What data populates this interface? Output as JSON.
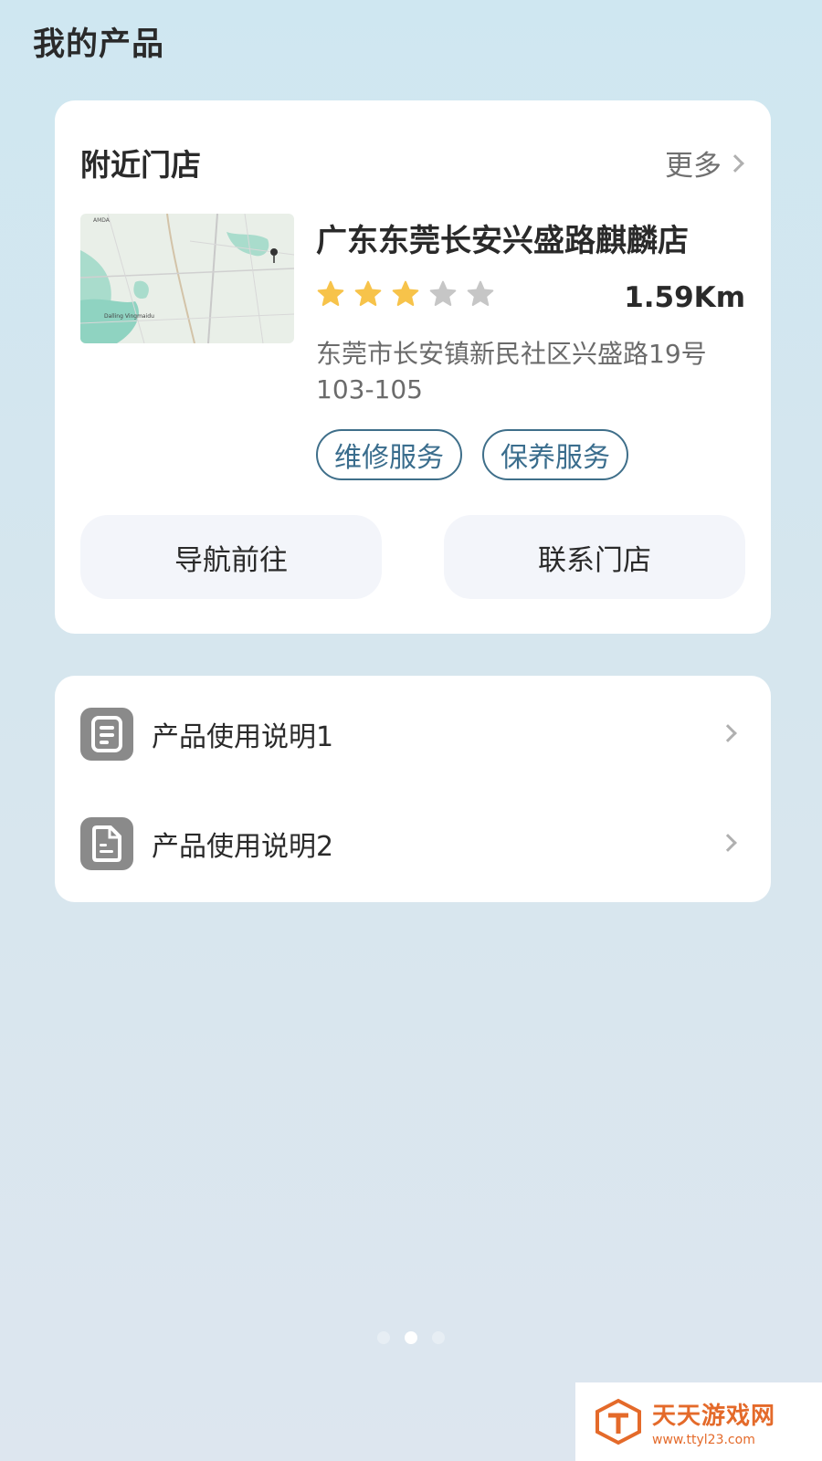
{
  "page": {
    "title": "我的产品"
  },
  "nearby_store": {
    "header_title": "附近门店",
    "more_label": "更多",
    "store": {
      "name": "广东东莞长安兴盛路麒麟店",
      "rating": 3,
      "rating_max": 5,
      "distance": "1.59Km",
      "address": "东莞市长安镇新民社区兴盛路19号103-105",
      "tags": [
        "维修服务",
        "保养服务"
      ]
    },
    "buttons": {
      "navigate": "导航前往",
      "contact": "联系门店"
    },
    "map": {
      "labels": [
        "AMDA",
        "Dalling Vingmaidu"
      ]
    }
  },
  "manuals": {
    "items": [
      {
        "label": "产品使用说明1",
        "icon": "document-list-icon"
      },
      {
        "label": "产品使用说明2",
        "icon": "document-file-icon"
      }
    ]
  },
  "pagination": {
    "total": 3,
    "active_index": 1
  },
  "watermark": {
    "title": "天天游戏网",
    "url": "www.ttyl23.com"
  },
  "colors": {
    "star_filled": "#f7c34a",
    "star_empty": "#c6c6c6",
    "tag_border": "#3f6f8a",
    "tag_text": "#3a6d8d",
    "watermark": "#e46a2a"
  }
}
